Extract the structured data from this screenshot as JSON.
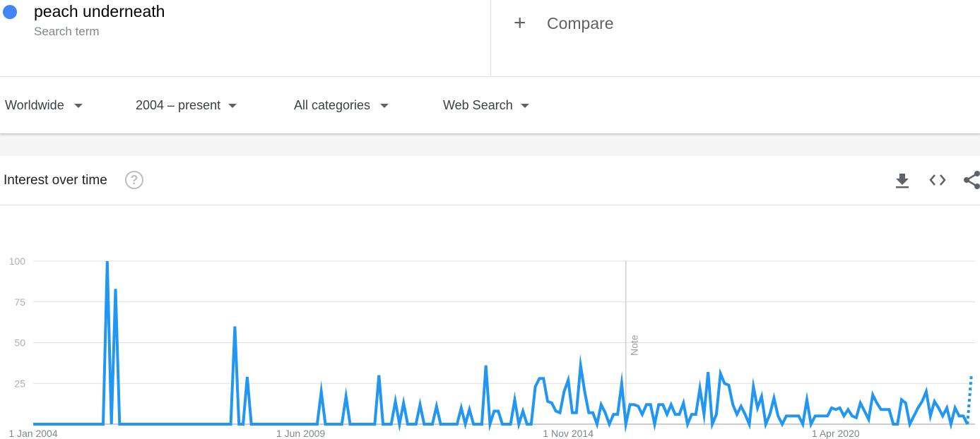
{
  "search_terms": [
    {
      "name": "peach underneath",
      "subtitle": "Search term",
      "color": "#4285f4"
    }
  ],
  "compare": {
    "icon": "plus-icon",
    "label": "Compare"
  },
  "filters": [
    {
      "label": "Worldwide"
    },
    {
      "label": "2004 – present"
    },
    {
      "label": "All categories"
    },
    {
      "label": "Web Search"
    }
  ],
  "card": {
    "title": "Interest over time",
    "help_icon": "?",
    "tools": [
      "download-icon",
      "embed-icon",
      "share-icon"
    ]
  },
  "chart_data": {
    "type": "line",
    "title": "Interest over time",
    "series": [
      {
        "name": "peach underneath",
        "color": "#2196f3"
      }
    ],
    "x_start": "2004-01",
    "x_step": "month",
    "x_ticks": [
      "1 Jan 2004",
      "1 Jun 2009",
      "1 Nov 2014",
      "1 Apr 2020"
    ],
    "x_tick_indices": [
      0,
      65,
      130,
      195
    ],
    "y_ticks": [
      "100",
      "75",
      "50",
      "25"
    ],
    "ylim": [
      0,
      100
    ],
    "grid": true,
    "annotations": [
      {
        "label": "Note",
        "index": 144
      }
    ],
    "partial_last_point": true,
    "values": [
      0,
      0,
      0,
      0,
      0,
      0,
      0,
      0,
      0,
      0,
      0,
      0,
      0,
      0,
      0,
      0,
      0,
      0,
      100,
      0,
      83,
      0,
      0,
      0,
      0,
      0,
      0,
      0,
      0,
      0,
      0,
      0,
      0,
      0,
      0,
      0,
      0,
      0,
      0,
      0,
      0,
      0,
      0,
      0,
      0,
      0,
      0,
      0,
      0,
      60,
      0,
      0,
      29,
      0,
      0,
      0,
      0,
      0,
      0,
      0,
      0,
      0,
      0,
      0,
      0,
      0,
      0,
      0,
      0,
      0,
      20,
      0,
      0,
      0,
      0,
      0,
      17,
      0,
      0,
      0,
      0,
      0,
      0,
      0,
      30,
      0,
      0,
      0,
      14,
      0,
      13,
      0,
      0,
      0,
      12,
      0,
      0,
      0,
      11,
      0,
      0,
      0,
      0,
      0,
      10,
      0,
      9,
      0,
      0,
      0,
      36,
      0,
      8,
      8,
      0,
      0,
      0,
      15,
      0,
      8,
      0,
      0,
      23,
      28,
      28,
      14,
      13,
      8,
      7,
      20,
      27,
      7,
      7,
      36,
      20,
      7,
      7,
      0,
      12,
      7,
      0,
      6,
      6,
      25,
      0,
      12,
      12,
      11,
      6,
      12,
      12,
      0,
      12,
      12,
      6,
      12,
      6,
      6,
      13,
      0,
      6,
      6,
      22,
      6,
      32,
      0,
      6,
      31,
      25,
      24,
      12,
      6,
      11,
      6,
      0,
      23,
      10,
      17,
      0,
      6,
      16,
      5,
      0,
      5,
      5,
      5,
      5,
      0,
      15,
      0,
      5,
      5,
      5,
      5,
      10,
      9,
      10,
      5,
      9,
      5,
      4,
      13,
      8,
      3,
      18,
      13,
      9,
      9,
      9,
      0,
      0,
      15,
      13,
      0,
      5,
      10,
      14,
      20,
      5,
      14,
      10,
      5,
      10,
      0,
      10,
      5,
      5,
      0,
      31
    ]
  }
}
